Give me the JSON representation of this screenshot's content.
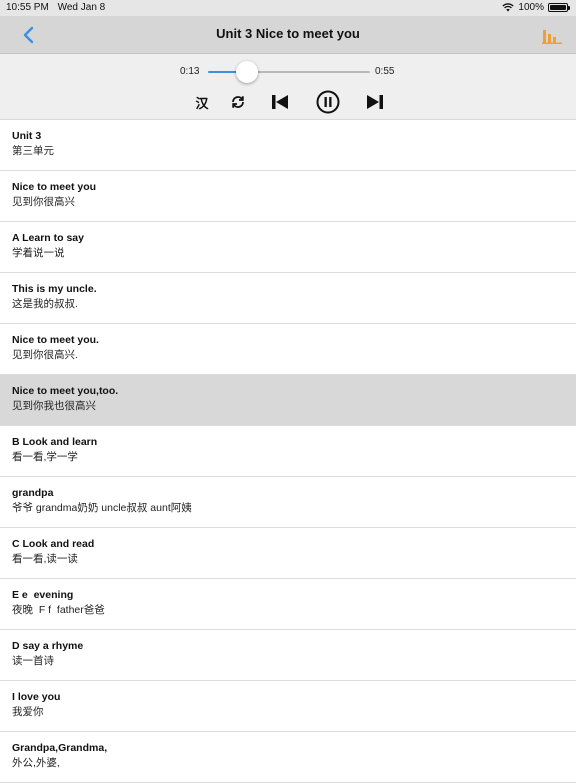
{
  "status_bar": {
    "time": "10:55 PM",
    "date": "Wed Jan 8",
    "battery": "100%"
  },
  "nav": {
    "title": "Unit 3  Nice to meet you",
    "accent_color": "#3d8fe0",
    "bars_color": "#f0a030"
  },
  "player": {
    "current_time": "0:13",
    "duration": "0:55",
    "progress": 0.24,
    "han_label": "汉"
  },
  "list": [
    {
      "en": "Unit 3",
      "zh": "第三单元",
      "selected": false
    },
    {
      "en": "Nice to meet you",
      "zh": "见到你很高兴",
      "selected": false
    },
    {
      "en": "A Learn to say",
      "zh": "学着说一说",
      "selected": false
    },
    {
      "en": "This is my uncle.",
      "zh": "这是我的叔叔.",
      "selected": false
    },
    {
      "en": "Nice to meet you.",
      "zh": "见到你很高兴.",
      "selected": false
    },
    {
      "en": "Nice to meet you,too.",
      "zh": "见到你我也很高兴",
      "selected": true
    },
    {
      "en": "B Look and learn",
      "zh": "看一看,学一学",
      "selected": false
    },
    {
      "en": "grandpa",
      "zh": "爷爷 grandma奶奶 uncle叔叔 aunt阿姨",
      "selected": false
    },
    {
      "en": "C Look and read",
      "zh": "看一看,读一读",
      "selected": false
    },
    {
      "en": "E e  evening",
      "zh": "夜晚  F f  father爸爸",
      "selected": false
    },
    {
      "en": "D say a rhyme",
      "zh": "读一首诗",
      "selected": false
    },
    {
      "en": "I love you",
      "zh": "我爱你",
      "selected": false
    },
    {
      "en": "Grandpa,Grandma,",
      "zh": "外公,外婆,",
      "selected": false
    }
  ]
}
